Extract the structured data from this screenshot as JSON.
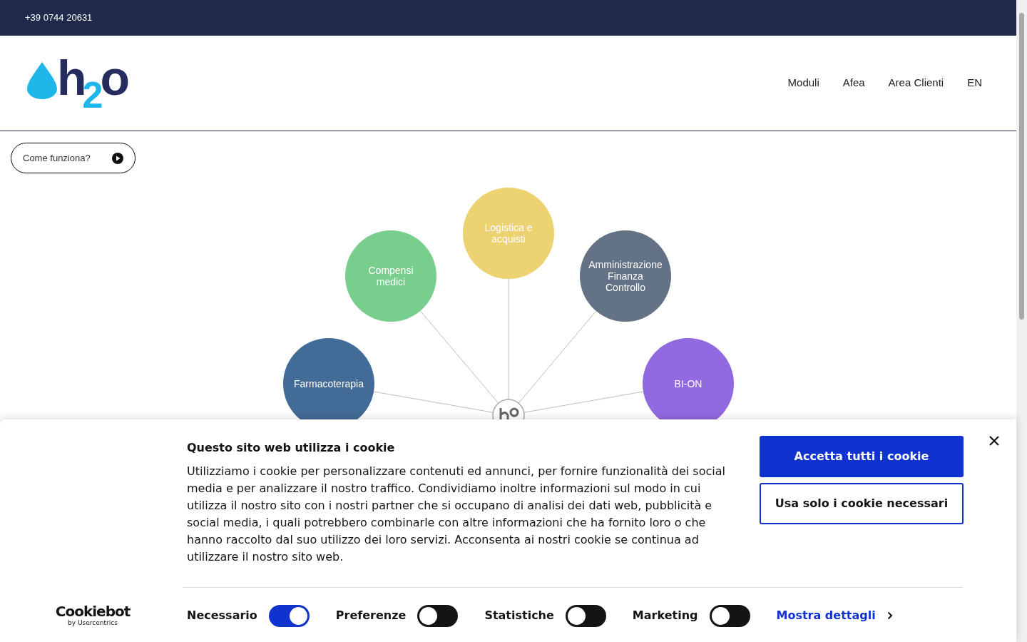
{
  "top_bar": {
    "phone": "+39 0744 20631"
  },
  "header": {
    "logo": [
      {
        "text": "h"
      },
      {
        "text": "2"
      },
      {
        "text": "o"
      }
    ],
    "nav": [
      "Moduli",
      "Afea",
      "Area Clienti",
      "EN"
    ]
  },
  "how_it_works_button": "Come funziona?",
  "modules": [
    {
      "label": "Farmacoterapia",
      "color": "#436b97"
    },
    {
      "label": "Compensi medici",
      "color": "#78cf8d"
    },
    {
      "label": "Logistica e acquisti",
      "color": "#edd271"
    },
    {
      "label": "Amministrazione Finanza Controllo",
      "color": "#637285"
    },
    {
      "label": "BI-ON",
      "color": "#9169e0"
    }
  ],
  "cookie_banner": {
    "title": "Questo sito web utilizza i cookie",
    "text": "Utilizziamo i cookie per personalizzare contenuti ed annunci, per fornire funzionalità dei social media e per analizzare il nostro traffico. Condividiamo inoltre informazioni sul modo in cui utilizza il nostro sito con i nostri partner che si occupano di analisi dei dati web, pubblicità e social media, i quali potrebbero combinarle con altre informazioni che ha fornito loro o che hanno raccolto dal suo utilizzo dei loro servizi. Acconsenta ai nostri cookie se continua ad utilizzare il nostro sito web.",
    "buttons": [
      {
        "label": "Accetta tutti i cookie",
        "kind": "primary"
      },
      {
        "label": "Usa solo i cookie necessari",
        "kind": "outline"
      }
    ],
    "brand": {
      "name": "Cookiebot",
      "byline": "by Usercentrics"
    },
    "toggles": [
      {
        "label": "Necessario",
        "checked": true
      },
      {
        "label": "Preferenze",
        "checked": false
      },
      {
        "label": "Statistiche",
        "checked": false
      },
      {
        "label": "Marketing",
        "checked": false
      }
    ],
    "details_link": "Mostra dettagli"
  }
}
